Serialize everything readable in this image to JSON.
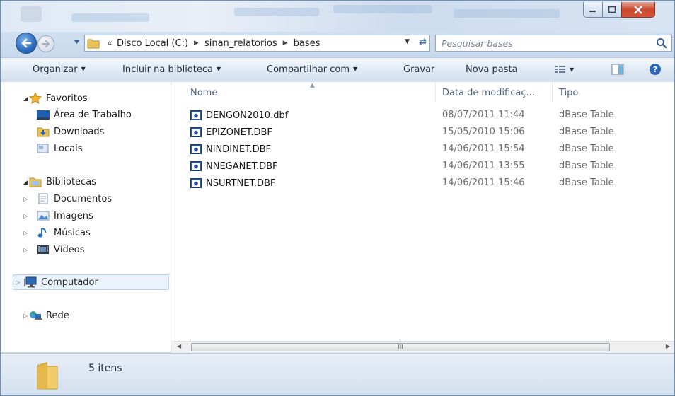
{
  "window": {
    "controls": {
      "minimize": "minimize",
      "maximize": "maximize",
      "close": "close"
    }
  },
  "address": {
    "overflow": "«",
    "path": [
      "Disco Local (C:)",
      "sinan_relatorios",
      "bases"
    ]
  },
  "search": {
    "placeholder": "Pesquisar bases"
  },
  "toolbar": {
    "organize": "Organizar",
    "include": "Incluir na biblioteca",
    "share": "Compartilhar com",
    "burn": "Gravar",
    "new_folder": "Nova pasta"
  },
  "sidebar": {
    "favorites": {
      "label": "Favoritos",
      "items": [
        "Área de Trabalho",
        "Downloads",
        "Locais"
      ]
    },
    "libraries": {
      "label": "Bibliotecas",
      "items": [
        "Documentos",
        "Imagens",
        "Músicas",
        "Vídeos"
      ]
    },
    "computer": "Computador",
    "network": "Rede"
  },
  "columns": {
    "name": "Nome",
    "date": "Data de modificaç...",
    "type": "Tipo"
  },
  "files": [
    {
      "name": "DENGON2010.dbf",
      "date": "08/07/2011 11:44",
      "type": "dBase Table"
    },
    {
      "name": "EPIZONET.DBF",
      "date": "15/05/2010 15:06",
      "type": "dBase Table"
    },
    {
      "name": "NINDINET.DBF",
      "date": "14/06/2011 15:54",
      "type": "dBase Table"
    },
    {
      "name": "NNEGANET.DBF",
      "date": "14/06/2011 13:55",
      "type": "dBase Table"
    },
    {
      "name": "NSURTNET.DBF",
      "date": "14/06/2011 15:46",
      "type": "dBase Table"
    }
  ],
  "scrollbar": {
    "grip": "III"
  },
  "status": {
    "count": "5 itens"
  },
  "colors": {
    "accent": "#3c6fb0",
    "close": "#c7472d",
    "selection": "#eaf3fc"
  }
}
